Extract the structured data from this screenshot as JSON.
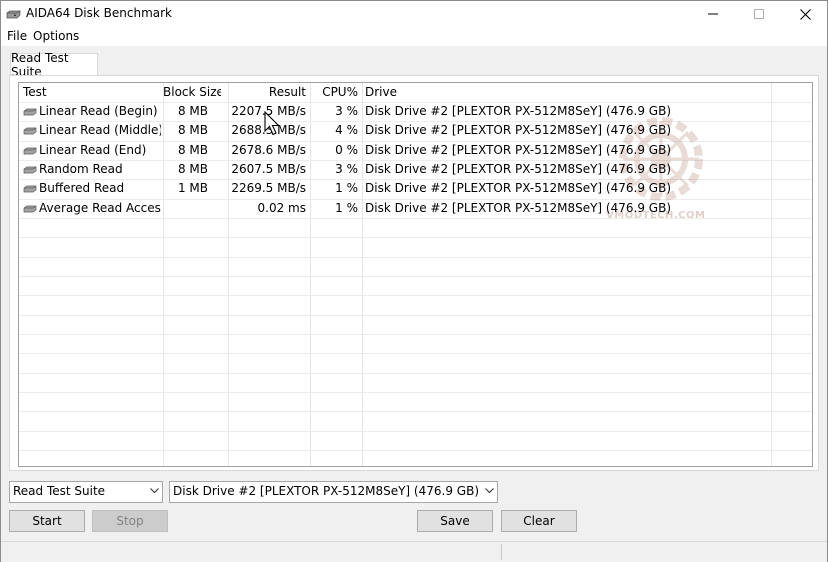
{
  "window": {
    "title": "AIDA64 Disk Benchmark",
    "icon": "disk-drive-icon",
    "controls": [
      "minimize-icon",
      "maximize-icon",
      "close-icon"
    ]
  },
  "menu": {
    "items": [
      {
        "label": "File"
      },
      {
        "label": "Options"
      }
    ]
  },
  "tab": {
    "label": "Read Test Suite"
  },
  "table": {
    "headers": [
      "Test",
      "Block Size",
      "Result",
      "CPU%",
      "Drive"
    ],
    "rows": [
      {
        "test": "Linear Read (Begin)",
        "block": "8 MB",
        "result": "2207.5 MB/s",
        "cpu": "3 %",
        "drive": "Disk Drive #2  [PLEXTOR PX-512M8SeY]  (476.9 GB)"
      },
      {
        "test": "Linear Read (Middle)",
        "block": "8 MB",
        "result": "2688.3 MB/s",
        "cpu": "4 %",
        "drive": "Disk Drive #2  [PLEXTOR PX-512M8SeY]  (476.9 GB)"
      },
      {
        "test": "Linear Read (End)",
        "block": "8 MB",
        "result": "2678.6 MB/s",
        "cpu": "0 %",
        "drive": "Disk Drive #2  [PLEXTOR PX-512M8SeY]  (476.9 GB)"
      },
      {
        "test": "Random Read",
        "block": "8 MB",
        "result": "2607.5 MB/s",
        "cpu": "3 %",
        "drive": "Disk Drive #2  [PLEXTOR PX-512M8SeY]  (476.9 GB)"
      },
      {
        "test": "Buffered Read",
        "block": "1 MB",
        "result": "2269.5 MB/s",
        "cpu": "1 %",
        "drive": "Disk Drive #2  [PLEXTOR PX-512M8SeY]  (476.9 GB)"
      },
      {
        "test": "Average Read Access",
        "block": "",
        "result": "0.02 ms",
        "cpu": "1 %",
        "drive": "Disk Drive #2  [PLEXTOR PX-512M8SeY]  (476.9 GB)"
      }
    ],
    "row_icon": "disk-drive-icon"
  },
  "watermark": {
    "text": "VMODTECH.COM"
  },
  "controls": {
    "suite_select": "Read Test Suite",
    "drive_select": "Disk Drive #2  [PLEXTOR PX-512M8SeY]  (476.9 GB)",
    "start": "Start",
    "stop": "Stop",
    "save": "Save",
    "clear": "Clear"
  },
  "colors": {
    "window_bg": "#f0f0f0",
    "grid_border": "#a0a0a0",
    "button_bg": "#e1e1e1",
    "disabled_button_bg": "#cccccc",
    "watermark": "#7a2c0e"
  }
}
